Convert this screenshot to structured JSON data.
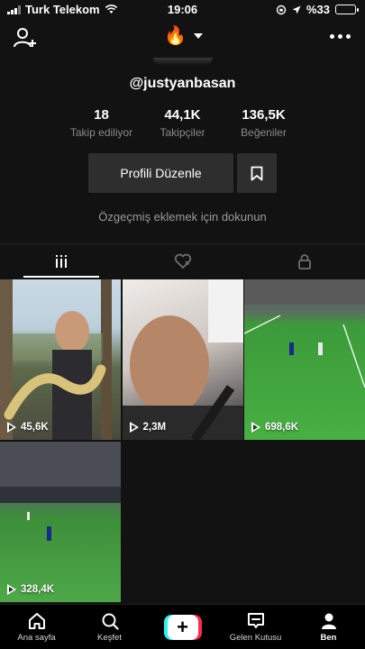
{
  "status_bar": {
    "carrier": "Turk Telekom",
    "time": "19:06",
    "battery": "%33",
    "battery_level": 0.33
  },
  "header": {
    "account_icon": "flame-emoji",
    "username": "@justyanbasan"
  },
  "stats": [
    {
      "value": "18",
      "label": "Takip ediliyor"
    },
    {
      "value": "44,1K",
      "label": "Takipçiler"
    },
    {
      "value": "136,5K",
      "label": "Beğeniler"
    }
  ],
  "actions": {
    "edit_profile": "Profili Düzenle"
  },
  "bio_prompt": "Özgeçmiş eklemek için dokunun",
  "tabs": [
    {
      "icon": "videos-grid-icon",
      "active": true
    },
    {
      "icon": "liked-heart-icon",
      "active": false
    },
    {
      "icon": "private-lock-icon",
      "active": false
    }
  ],
  "videos": [
    {
      "views": "45,6K"
    },
    {
      "views": "2,3M"
    },
    {
      "views": "698,6K"
    },
    {
      "views": "328,4K"
    }
  ],
  "bottom_nav": [
    {
      "label": "Ana sayfa",
      "icon": "home-icon"
    },
    {
      "label": "Keşfet",
      "icon": "search-icon"
    },
    {
      "label": "",
      "icon": "create-plus-icon"
    },
    {
      "label": "Gelen Kutusu",
      "icon": "inbox-icon"
    },
    {
      "label": "Ben",
      "icon": "profile-icon",
      "active": true
    }
  ],
  "colors": {
    "background": "#121212",
    "button": "#2e2e2e",
    "accent_cyan": "#25f4ee",
    "accent_red": "#fe2c55"
  }
}
